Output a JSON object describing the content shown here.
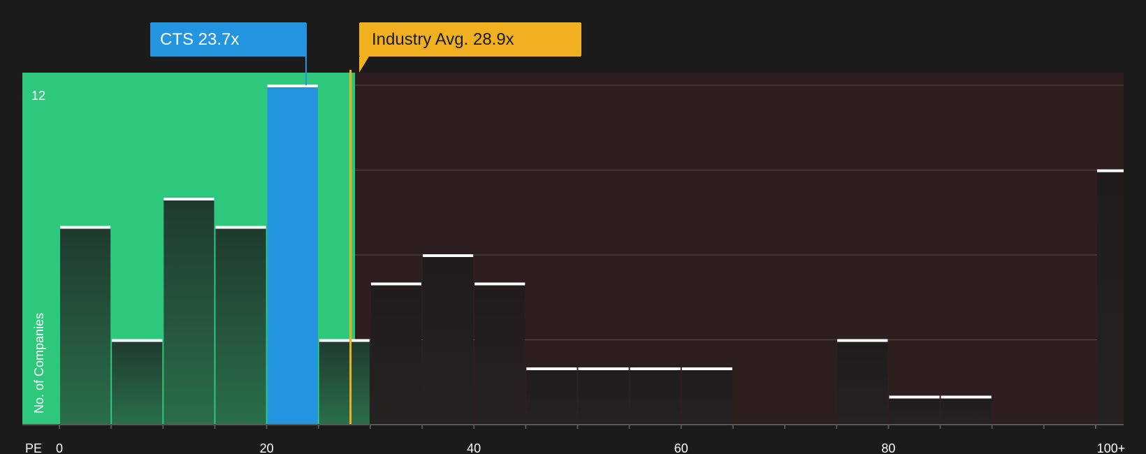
{
  "chart_data": {
    "type": "bar",
    "xlabel": "PE",
    "ylabel": "No. of Companies",
    "x_ticks": [
      "0",
      "20",
      "40",
      "60",
      "80",
      "100+"
    ],
    "y_ticks": [
      "12"
    ],
    "ylim": [
      0,
      12.4
    ],
    "bin_width": 5,
    "bins": [
      {
        "x0": 0,
        "x1": 5,
        "count": 7
      },
      {
        "x0": 5,
        "x1": 10,
        "count": 3
      },
      {
        "x0": 10,
        "x1": 15,
        "count": 8
      },
      {
        "x0": 15,
        "x1": 20,
        "count": 7
      },
      {
        "x0": 20,
        "x1": 25,
        "count": 12,
        "highlight": true
      },
      {
        "x0": 25,
        "x1": 30,
        "count": 3
      },
      {
        "x0": 30,
        "x1": 35,
        "count": 5
      },
      {
        "x0": 35,
        "x1": 40,
        "count": 6
      },
      {
        "x0": 40,
        "x1": 45,
        "count": 5
      },
      {
        "x0": 45,
        "x1": 50,
        "count": 2
      },
      {
        "x0": 50,
        "x1": 55,
        "count": 2
      },
      {
        "x0": 55,
        "x1": 60,
        "count": 2
      },
      {
        "x0": 60,
        "x1": 65,
        "count": 2
      },
      {
        "x0": 65,
        "x1": 70,
        "count": 0
      },
      {
        "x0": 70,
        "x1": 75,
        "count": 0
      },
      {
        "x0": 75,
        "x1": 80,
        "count": 3
      },
      {
        "x0": 80,
        "x1": 85,
        "count": 1
      },
      {
        "x0": 85,
        "x1": 90,
        "count": 1
      },
      {
        "x0": 90,
        "x1": 95,
        "count": 0
      },
      {
        "x0": 95,
        "x1": 100,
        "count": 0
      },
      {
        "x0": 100,
        "x1": 105,
        "count": 9,
        "overflow": true
      }
    ],
    "fair_range": [
      0,
      28
    ],
    "company": {
      "label": "CTS 23.7x",
      "value": 23.7
    },
    "industry": {
      "label": "Industry Avg. 28.9x",
      "value": 28.9
    },
    "colors": {
      "background": "#1b1b1b",
      "fair_zone": "#2ec87c",
      "over_zone": "#2d1e1f",
      "highlight_bar": "#2394e0",
      "industry_line": "#f0b020",
      "bar_cap": "#ffffff"
    }
  }
}
